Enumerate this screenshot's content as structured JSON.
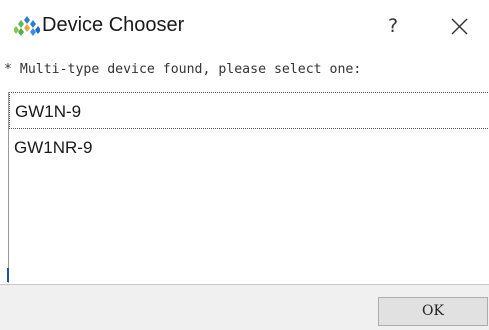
{
  "window": {
    "title": "Device Chooser",
    "help_label": "?",
    "app_icon": "gowin-logo-icon",
    "close_icon": "close-icon"
  },
  "prompt": "* Multi-type device found, please select one:",
  "devices": [
    {
      "label": "GW1N-9",
      "selected": true
    },
    {
      "label": "GW1NR-9",
      "selected": false
    }
  ],
  "footer": {
    "ok_label": "OK"
  },
  "colors": {
    "logo_green": "#5cb85c",
    "logo_blue": "#2a7fd4",
    "background": "#ffffff",
    "footer_bg": "#f0f0f0"
  }
}
